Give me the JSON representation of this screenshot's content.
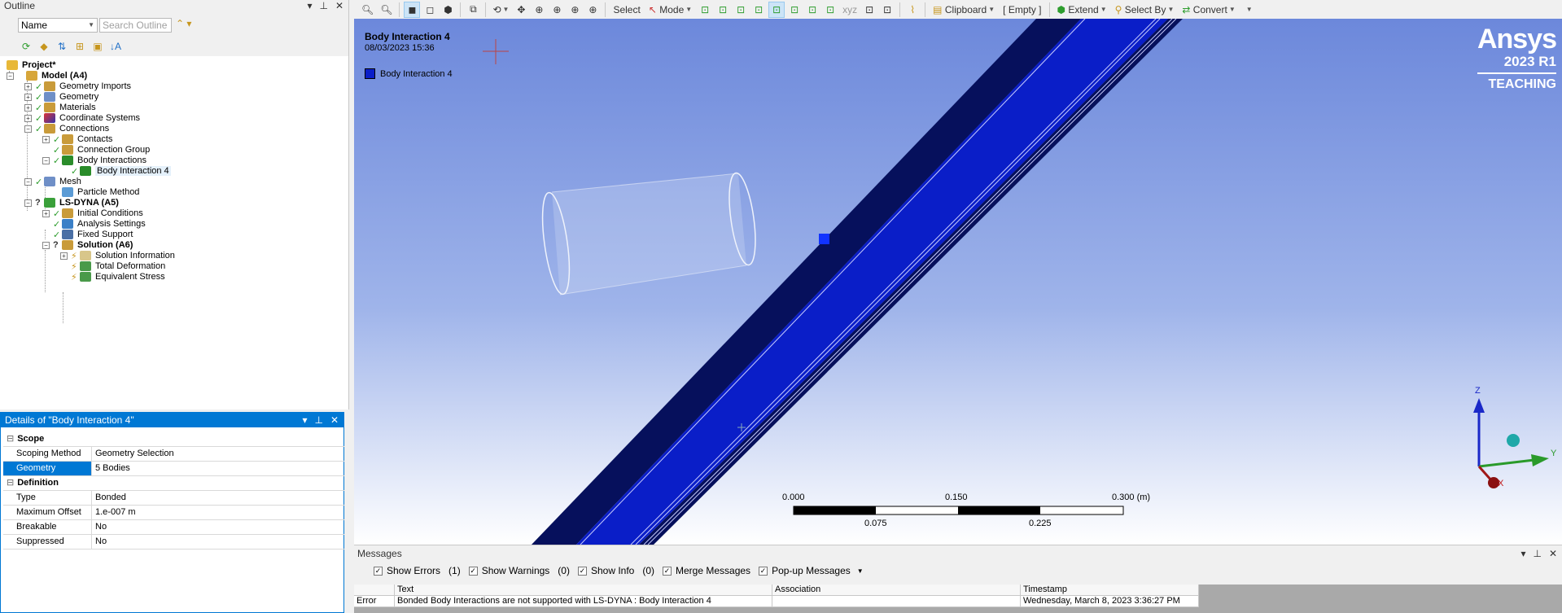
{
  "outline": {
    "title": "Outline",
    "filter_select": "Name",
    "search_placeholder": "Search Outline",
    "tree": [
      {
        "label": "Project*",
        "bold": true
      },
      {
        "label": "Model (A4)",
        "bold": true
      },
      {
        "label": "Geometry Imports"
      },
      {
        "label": "Geometry"
      },
      {
        "label": "Materials"
      },
      {
        "label": "Coordinate Systems"
      },
      {
        "label": "Connections"
      },
      {
        "label": "Contacts"
      },
      {
        "label": "Connection Group"
      },
      {
        "label": "Body Interactions"
      },
      {
        "label": "Body Interaction 4"
      },
      {
        "label": "Mesh"
      },
      {
        "label": "Particle Method"
      },
      {
        "label": "LS-DYNA (A5)",
        "bold": true
      },
      {
        "label": "Initial Conditions"
      },
      {
        "label": "Analysis Settings"
      },
      {
        "label": "Fixed Support"
      },
      {
        "label": "Solution (A6)",
        "bold": true
      },
      {
        "label": "Solution Information"
      },
      {
        "label": "Total Deformation"
      },
      {
        "label": "Equivalent Stress"
      }
    ]
  },
  "details": {
    "title": "Details of \"Body Interaction 4\"",
    "groups": [
      {
        "name": "Scope",
        "rows": [
          {
            "key": "Scoping Method",
            "value": "Geometry Selection"
          },
          {
            "key": "Geometry",
            "value": "5 Bodies"
          }
        ]
      },
      {
        "name": "Definition",
        "rows": [
          {
            "key": "Type",
            "value": "Bonded"
          },
          {
            "key": "Maximum Offset",
            "value": "1.e-007 m"
          },
          {
            "key": "Breakable",
            "value": "No"
          },
          {
            "key": "Suppressed",
            "value": "No"
          }
        ]
      }
    ]
  },
  "toolbar": {
    "select": "Select",
    "mode": "Mode",
    "clipboard": "Clipboard",
    "empty": "[ Empty ]",
    "extend": "Extend",
    "select_by": "Select By",
    "convert": "Convert"
  },
  "viewport": {
    "title": "Body Interaction 4",
    "date": "08/03/2023 15:36",
    "legend_label": "Body Interaction 4",
    "legend_color": "#0a1ec8",
    "brand_name": "Ansys",
    "brand_version": "2023 R1",
    "brand_edition": "TEACHING",
    "scale_top": [
      "0.000",
      "0.150",
      "0.300 (m)"
    ],
    "scale_bottom": [
      "0.075",
      "0.225"
    ],
    "axes": {
      "z": "Z",
      "y": "Y",
      "x": "X"
    }
  },
  "messages": {
    "title": "Messages",
    "filters": [
      {
        "label": "Show Errors",
        "count": "(1)"
      },
      {
        "label": "Show Warnings",
        "count": "(0)"
      },
      {
        "label": "Show Info",
        "count": "(0)"
      },
      {
        "label": "Merge Messages",
        "count": ""
      },
      {
        "label": "Pop-up Messages",
        "count": ""
      }
    ],
    "columns": [
      "",
      "Text",
      "Association",
      "Timestamp"
    ],
    "rows": [
      {
        "type": "Error",
        "text": "Bonded Body Interactions are not supported with LS-DYNA : Body Interaction 4",
        "association": "",
        "timestamp": "Wednesday, March 8, 2023 3:36:27 PM"
      }
    ]
  }
}
